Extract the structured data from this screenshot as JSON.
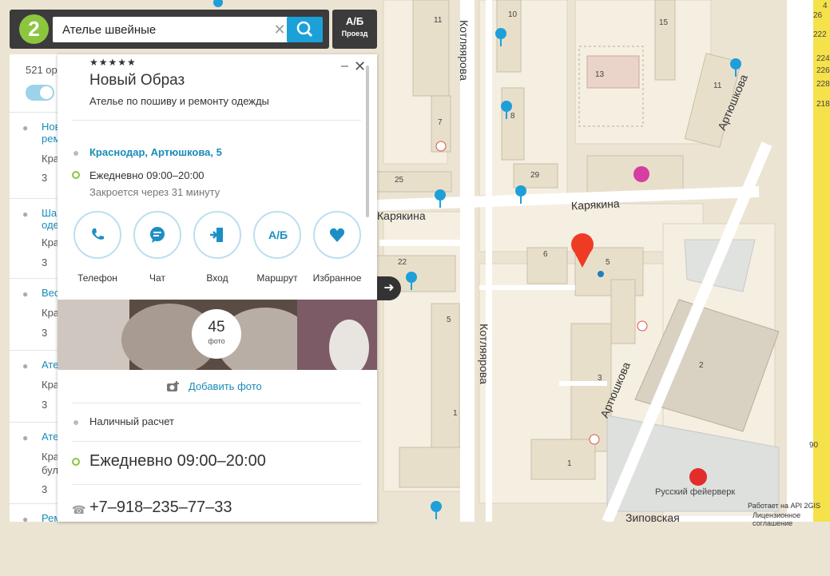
{
  "search": {
    "query": "Ателье швейные",
    "logo": "2"
  },
  "route_button": {
    "icon_text": "А/Б",
    "label": "Проезд"
  },
  "results": {
    "count": "521 ор",
    "items": [
      {
        "t1": "Нов",
        "t1b": "рем",
        "t2": "Кра",
        "t3": "3"
      },
      {
        "t1": "Шаг",
        "t1b": "оде",
        "t2": "Кра",
        "t3": "3"
      },
      {
        "t1": "Вес",
        "t2": "Кра",
        "t3": "3"
      },
      {
        "t1": "Ате",
        "t2": "Кра",
        "t3": "3"
      },
      {
        "t1": "Ате",
        "t2": "Кра",
        "t2b": "бул",
        "t3": "3"
      },
      {
        "t1": "Рем"
      }
    ]
  },
  "card": {
    "stars": "★★★★★",
    "name": "Новый Образ",
    "description": "Ателье по пошиву и ремонту одежды",
    "address": "Краснодар, Артюшкова, 5",
    "hours": "Ежедневно 09:00–20:00",
    "closes": "Закроется через 31 минуту",
    "actions": [
      "Телефон",
      "Чат",
      "Вход",
      "Маршрут",
      "Избранное"
    ],
    "route_icon": "А/Б",
    "photo_count": "45",
    "photo_label": "фото",
    "add_photo": "Добавить фото",
    "payment": "Наличный расчет",
    "hours_large": "Ежедневно 09:00–20:00",
    "phone": "+7–918–235–77–33"
  },
  "map": {
    "streets": [
      "Котляярова",
      "Котляярова",
      "Карякина",
      "Карякина",
      "Артюшкова",
      "Артюшкова",
      "Зиповская"
    ],
    "building_numbers": [
      "11",
      "10",
      "15",
      "13",
      "7",
      "8",
      "11",
      "29",
      "25",
      "6",
      "5",
      "22",
      "5",
      "2",
      "3",
      "1",
      "1",
      "90",
      "4",
      "26",
      "222",
      "224",
      "226",
      "228",
      "218"
    ],
    "poi": "Русский фейерверк",
    "credit1": "Работает на API 2GIS",
    "credit2": "Лицензионное соглашение"
  },
  "colors": {
    "accent": "#1ba1d8",
    "logo": "#8cc63f",
    "marker": "#ef3b24",
    "pin": "#1e9fd8",
    "road_major": "#f5e14a"
  }
}
